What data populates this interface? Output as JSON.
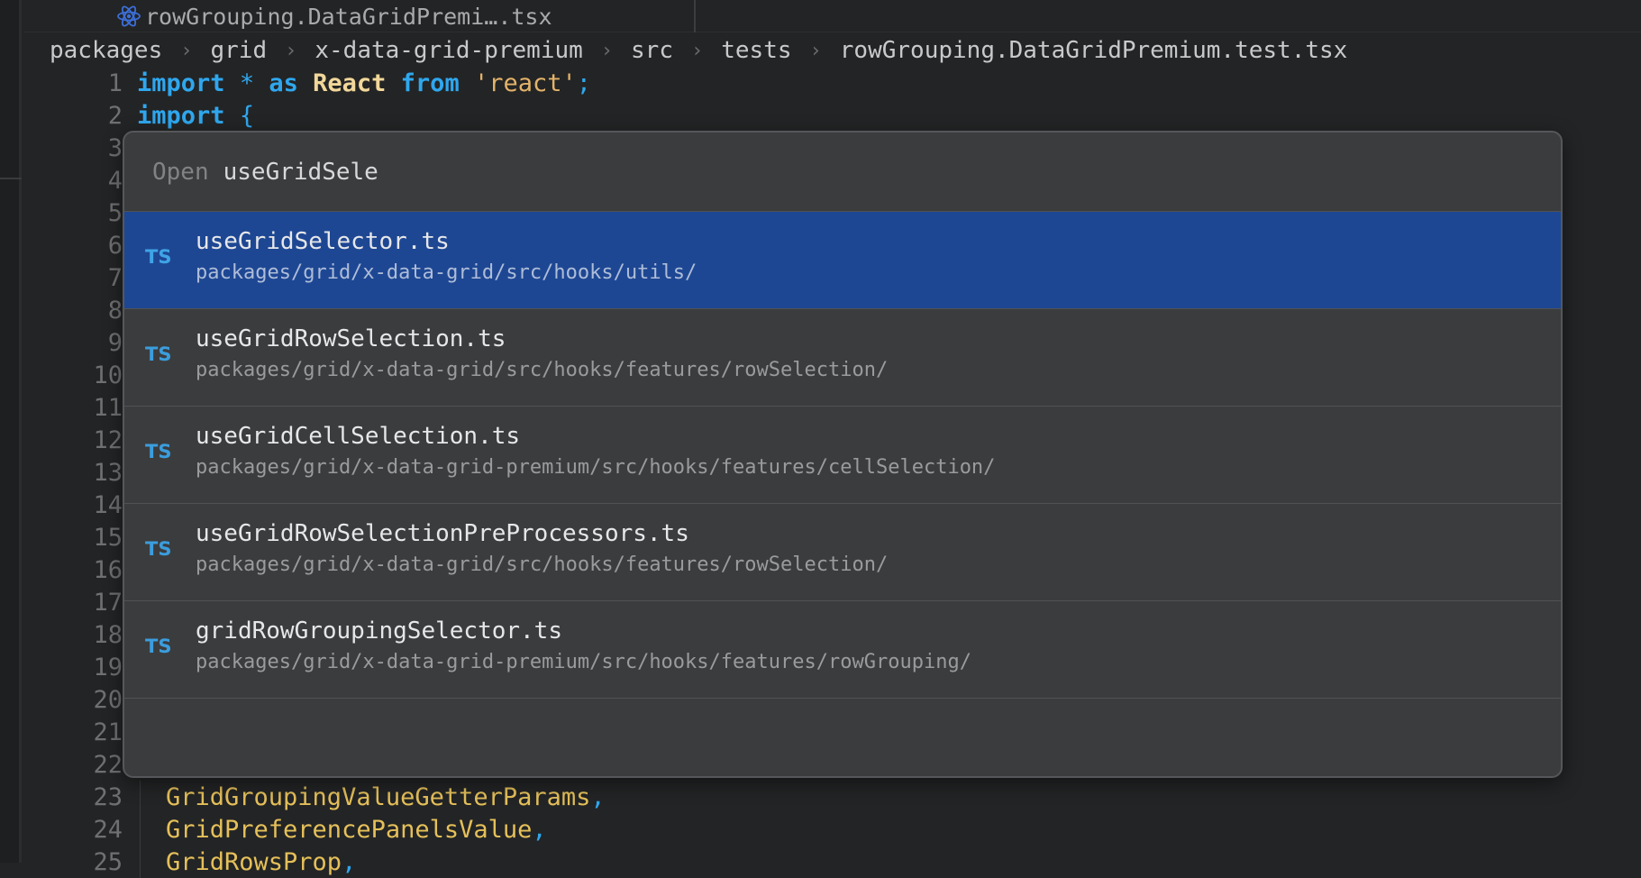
{
  "tab": {
    "title": "rowGrouping.DataGridPremi….tsx",
    "icon": "react-icon"
  },
  "breadcrumb": [
    "packages",
    "grid",
    "x-data-grid-premium",
    "src",
    "tests",
    "rowGrouping.DataGridPremium.test.tsx"
  ],
  "editor": {
    "visible_line_numbers": [
      "1",
      "2",
      "3",
      "4",
      "5",
      "6",
      "7",
      "8",
      "9",
      "10",
      "11",
      "12",
      "13",
      "14",
      "15",
      "16",
      "17",
      "18",
      "19",
      "20",
      "21",
      "22",
      "23",
      "24",
      "25"
    ],
    "line1": {
      "kw1": "import",
      "op": "*",
      "kw2": "as",
      "id": "React",
      "kw3": "from",
      "str": "'react'",
      "end": ";"
    },
    "line2": {
      "kw": "import",
      "brace": "{"
    },
    "line23": {
      "type": "GridGroupingValueGetterParams",
      "punct": ","
    },
    "line24": {
      "type": "GridPreferencePanelsValue",
      "punct": ","
    },
    "line25": {
      "type": "GridRowsProp",
      "punct": ","
    }
  },
  "goto_file": {
    "label": "Open",
    "query": "useGridSele",
    "results": [
      {
        "badge": "TS",
        "name": "useGridSelector.ts",
        "path": "packages/grid/x-data-grid/src/hooks/utils/",
        "selected": true
      },
      {
        "badge": "TS",
        "name": "useGridRowSelection.ts",
        "path": "packages/grid/x-data-grid/src/hooks/features/rowSelection/",
        "selected": false
      },
      {
        "badge": "TS",
        "name": "useGridCellSelection.ts",
        "path": "packages/grid/x-data-grid-premium/src/hooks/features/cellSelection/",
        "selected": false
      },
      {
        "badge": "TS",
        "name": "useGridRowSelectionPreProcessors.ts",
        "path": "packages/grid/x-data-grid/src/hooks/features/rowSelection/",
        "selected": false
      },
      {
        "badge": "TS",
        "name": "gridRowGroupingSelector.ts",
        "path": "packages/grid/x-data-grid-premium/src/hooks/features/rowGrouping/",
        "selected": false
      }
    ]
  },
  "colors": {
    "editor_bg": "#232425",
    "popup_bg": "#3b3c3e",
    "selection": "#1e4793",
    "keyword": "#2fa7ee",
    "type": "#e5c05a",
    "string": "#e3b36a"
  }
}
